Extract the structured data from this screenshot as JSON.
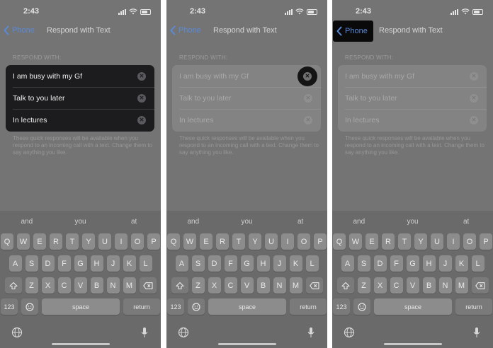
{
  "status": {
    "time": "2:43"
  },
  "nav": {
    "back_label": "Phone",
    "title": "Respond with Text"
  },
  "section_label": "RESPOND WITH:",
  "responses": [
    "I am busy with my Gf",
    "Talk to you later",
    "In lectures"
  ],
  "footnote": "These quick responses will be available when you respond to an incoming call with a text. Change them to say anything you like.",
  "keyboard": {
    "suggestions": [
      "and",
      "you",
      "at"
    ],
    "row1": [
      "Q",
      "W",
      "E",
      "R",
      "T",
      "Y",
      "U",
      "I",
      "O",
      "P"
    ],
    "row2": [
      "A",
      "S",
      "D",
      "F",
      "G",
      "H",
      "J",
      "K",
      "L"
    ],
    "row3": [
      "Z",
      "X",
      "C",
      "V",
      "B",
      "N",
      "M"
    ],
    "numbers_label": "123",
    "space_label": "space",
    "return_label": "return"
  },
  "icons": {
    "back": "chevron-left-icon",
    "clear": "clear-x-icon",
    "shift": "shift-icon",
    "delete": "delete-icon",
    "emoji": "emoji-icon",
    "globe": "globe-icon",
    "mic": "microphone-icon"
  },
  "colors": {
    "accent": "#5a8ad8",
    "panel_bg": "#747474",
    "group_active": "#1c1c1e"
  }
}
